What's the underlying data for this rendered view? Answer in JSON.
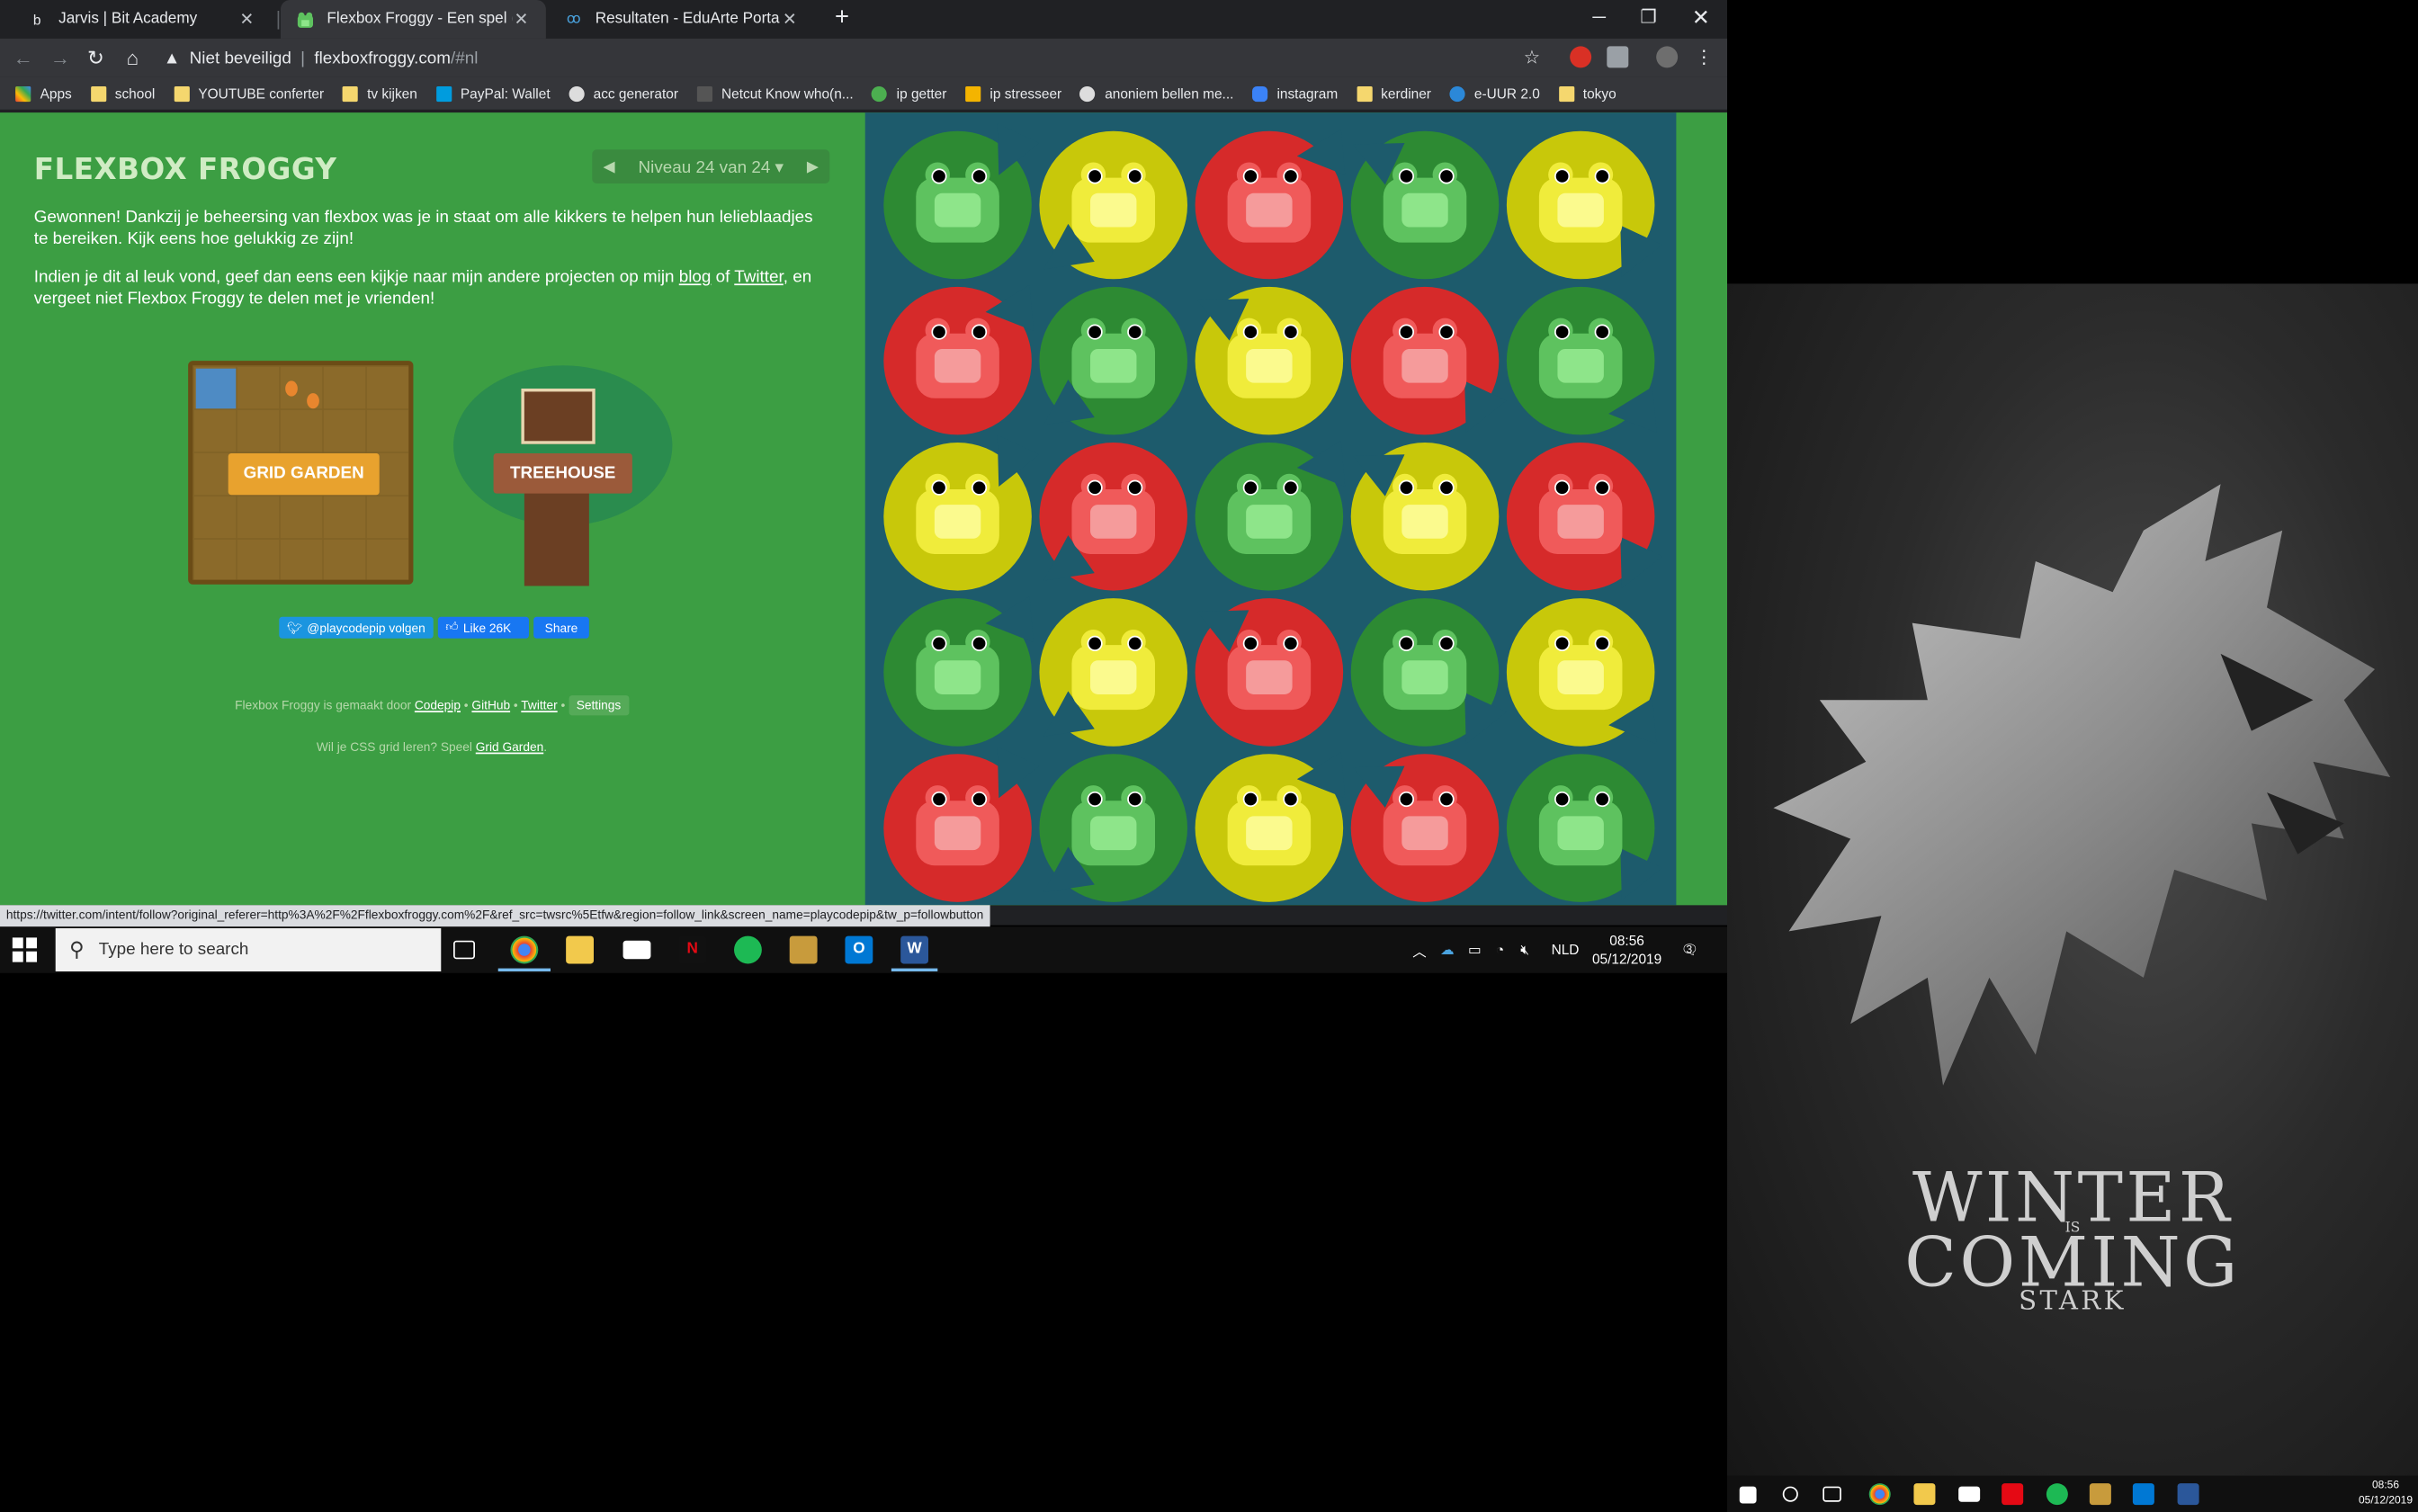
{
  "browser": {
    "tabs": [
      {
        "favicon": "b",
        "title": "Jarvis | Bit Academy"
      },
      {
        "favicon": "frog",
        "title": "Flexbox Froggy - Een spel om CS"
      },
      {
        "favicon": "ea",
        "title": "Resultaten - EduArte Portalen"
      }
    ],
    "security_label": "Niet beveiligd",
    "url_host": "flexboxfroggy.com",
    "url_path": "/#nl",
    "bookmarks": [
      "Apps",
      "school",
      "YOUTUBE conferter",
      "tv kijken",
      "PayPal: Wallet",
      "acc generator",
      "Netcut Know who(n...",
      "ip getter",
      "ip stresseer",
      "anoniem bellen me...",
      "instagram",
      "kerdiner",
      "e-UUR 2.0",
      "tokyo"
    ]
  },
  "page": {
    "logo": "FLEXBOX FROGGY",
    "level_label": "Niveau 24 van 24",
    "win_text": "Gewonnen! Dankzij je beheersing van flexbox was je in staat om alle kikkers te helpen hun lelieblaadjes te bereiken. Kijk eens hoe gelukkig ze zijn!",
    "share_text_1": "Indien je dit al leuk vond, geef dan eens een kijkje naar mijn andere projecten op mijn ",
    "share_link_blog": "blog",
    "share_text_2": " of ",
    "share_link_twitter": "Twitter",
    "share_text_3": ", en vergeet niet Flexbox Froggy te delen met je vrienden!",
    "grid_garden_label": "GRID GARDEN",
    "treehouse_label": "TREEHOUSE",
    "twitter_follow": "@playcodepip volgen",
    "fb_like": "Like 26K",
    "fb_share": "Share",
    "footer_made_by": "Flexbox Froggy is gemaakt door ",
    "footer_codepip": "Codepip",
    "footer_github": "GitHub",
    "footer_twitter": "Twitter",
    "footer_settings": "Settings",
    "footer_dot": " • ",
    "footer_grid_text": "Wil je CSS grid leren? Speel ",
    "footer_grid_link": "Grid Garden",
    "footer_grid_end": "."
  },
  "board": {
    "rows": [
      [
        "green",
        "yellow",
        "red",
        "green",
        "yellow"
      ],
      [
        "red",
        "green",
        "yellow",
        "red",
        "green"
      ],
      [
        "yellow",
        "red",
        "green",
        "yellow",
        "red"
      ],
      [
        "green",
        "yellow",
        "red",
        "green",
        "yellow"
      ],
      [
        "red",
        "green",
        "yellow",
        "red",
        "green"
      ]
    ],
    "colors": {
      "green": {
        "pad": "#2d8a33",
        "frog": "#5ec25f",
        "belly": "#8ee58a",
        "eye": "#5ec25f"
      },
      "yellow": {
        "pad": "#c8c80a",
        "frog": "#f0ec3b",
        "belly": "#fbfa8e",
        "eye": "#f0ec3b"
      },
      "red": {
        "pad": "#d62a2a",
        "frog": "#f05a5a",
        "belly": "#f59b9b",
        "eye": "#f05a5a"
      }
    }
  },
  "status_url": "https://twitter.com/intent/follow?original_referer=http%3A%2F%2Fflexboxfroggy.com%2F&ref_src=twsrc%5Etfw&region=follow_link&screen_name=playcodepip&tw_p=followbutton",
  "taskbar": {
    "search_placeholder": "Type here to search",
    "language": "NLD",
    "time": "08:56",
    "date": "05/12/2019",
    "notification_count": "3"
  },
  "monitor2": {
    "line1": "WINTER",
    "line2_is": "IS",
    "line2": "COMING",
    "line3": "STARK",
    "time": "08:56",
    "date": "05/12/2019"
  }
}
